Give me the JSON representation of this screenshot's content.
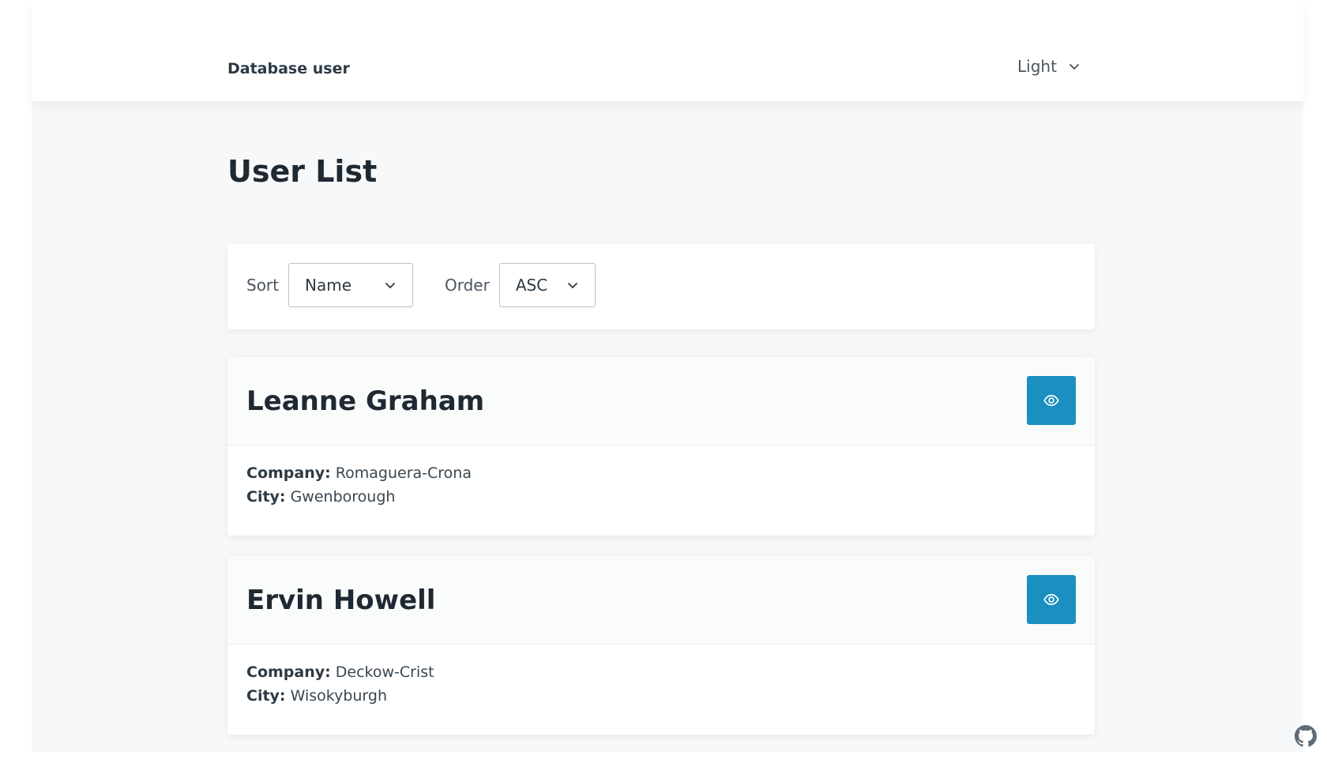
{
  "navbar": {
    "brand": "Database user",
    "theme_value": "Light"
  },
  "page_title": "User List",
  "filters": {
    "sort_label": "Sort",
    "sort_value": "Name",
    "order_label": "Order",
    "order_value": "ASC"
  },
  "users": [
    {
      "name": "Leanne Graham",
      "company_label": "Company:",
      "company": "Romaguera-Crona",
      "city_label": "City:",
      "city": "Gwenborough"
    },
    {
      "name": "Ervin Howell",
      "company_label": "Company:",
      "company": "Deckow-Crist",
      "city_label": "City:",
      "city": "Wisokyburgh"
    }
  ],
  "icons": {
    "view": "eye-icon",
    "dropdown": "chevron-down-icon",
    "footer": "github-icon"
  },
  "colors": {
    "accent": "#1a8fc0",
    "background": "#f7f8f9",
    "card": "#ffffff"
  }
}
